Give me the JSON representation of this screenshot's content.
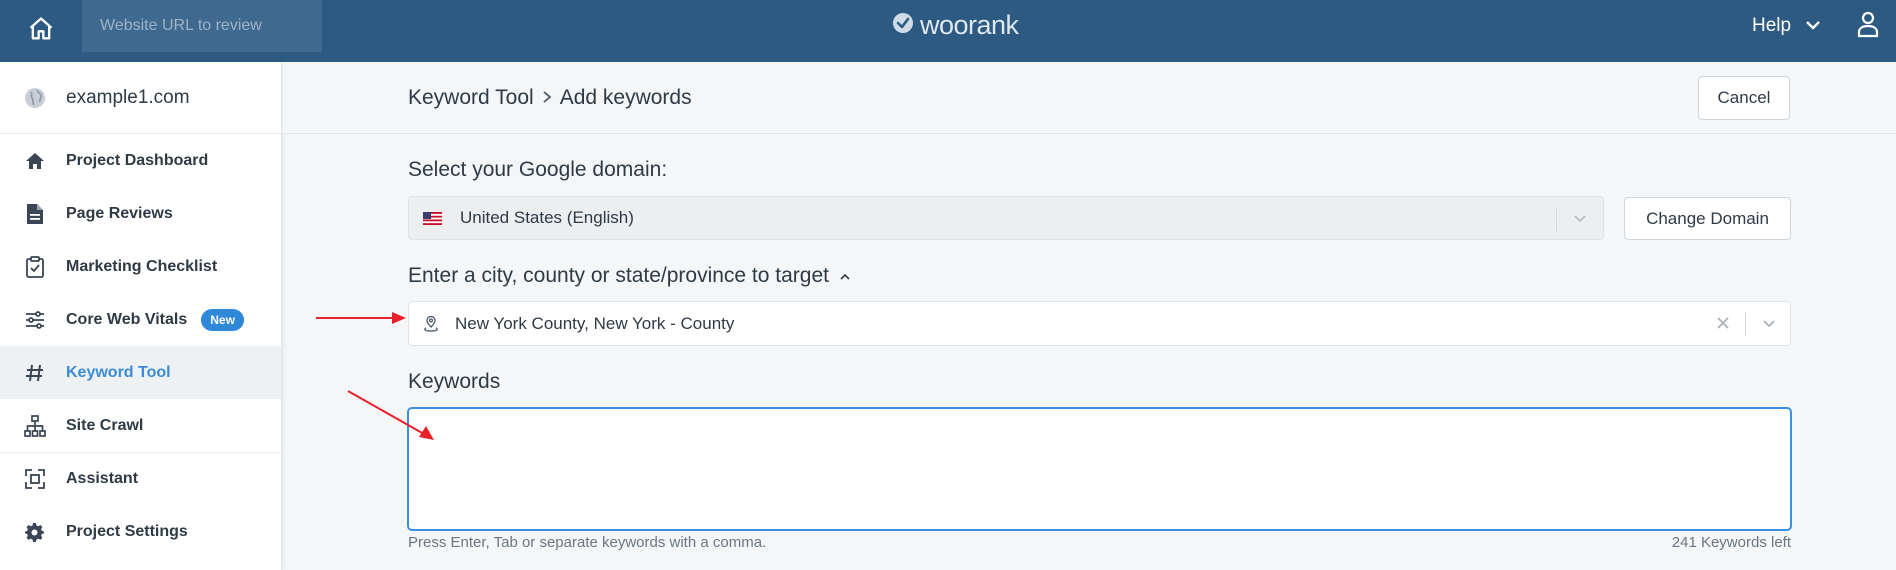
{
  "topbar": {
    "url_placeholder": "Website URL to review",
    "logo_text": "woorank",
    "help_label": "Help"
  },
  "sidebar": {
    "project_name": "example1.com",
    "items": [
      {
        "label": "Project Dashboard",
        "icon": "home-icon"
      },
      {
        "label": "Page Reviews",
        "icon": "document-icon"
      },
      {
        "label": "Marketing Checklist",
        "icon": "clipboard-check-icon"
      },
      {
        "label": "Core Web Vitals",
        "icon": "sliders-icon",
        "badge": "New"
      },
      {
        "label": "Keyword Tool",
        "icon": "hashtag-icon",
        "active": true
      },
      {
        "label": "Site Crawl",
        "icon": "sitemap-icon"
      },
      {
        "label": "Assistant",
        "icon": "assistant-icon"
      },
      {
        "label": "Project Settings",
        "icon": "gear-icon"
      }
    ]
  },
  "header": {
    "breadcrumb_parent": "Keyword Tool",
    "breadcrumb_current": "Add keywords",
    "cancel_label": "Cancel"
  },
  "form": {
    "domain_title": "Select your Google domain:",
    "domain_value": "United States (English)",
    "change_domain_label": "Change Domain",
    "location_title": "Enter a city, county or state/province to target",
    "location_value": "New York County, New York - County",
    "keywords_title": "Keywords",
    "keywords_value": "",
    "help_text": "Press Enter, Tab or separate keywords with a comma.",
    "keywords_left": "241 Keywords left"
  },
  "colors": {
    "topbar": "#2c5a82",
    "accent": "#3d8bd6",
    "badge": "#2f88d8",
    "annotation_arrow": "#e8202a"
  }
}
